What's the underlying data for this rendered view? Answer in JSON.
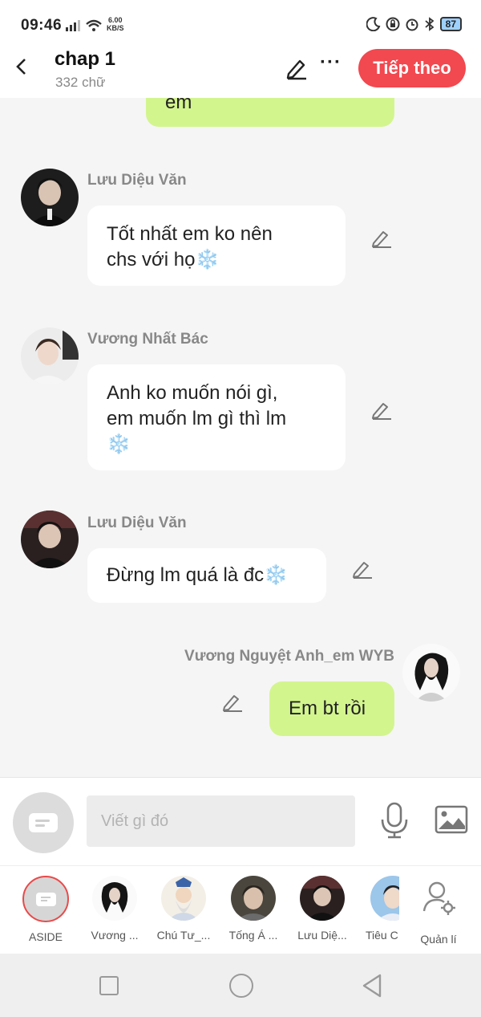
{
  "status_bar": {
    "time": "09:46",
    "speed_value": "6.00",
    "speed_unit": "KB/S",
    "battery": "87",
    "icons": [
      "signal-icon",
      "wifi-icon",
      "moon-icon",
      "lock-rotation-icon",
      "alarm-icon",
      "bluetooth-icon",
      "battery-icon"
    ]
  },
  "header": {
    "title": "chap 1",
    "subtitle": "332 chữ",
    "next_label": "Tiếp theo"
  },
  "messages": [
    {
      "sender": "",
      "text": "em",
      "side": "right"
    },
    {
      "sender": "Lưu Diệu Văn",
      "text_lines": [
        "Tốt nhất em ko nên",
        "chs với họ❄️"
      ],
      "side": "left"
    },
    {
      "sender": "Vương Nhất Bác",
      "text_lines": [
        "Anh ko muốn nói gì,",
        "em muốn lm gì thì lm",
        "❄️"
      ],
      "side": "left"
    },
    {
      "sender": "Lưu Diệu Văn",
      "text": "Đừng lm quá là đc❄️",
      "side": "left"
    },
    {
      "sender": "Vương Nguyệt Anh_em WYB",
      "text": "Em bt rồi",
      "side": "right"
    }
  ],
  "input": {
    "placeholder": "Viết gì đó"
  },
  "characters": [
    {
      "name": "ASIDE"
    },
    {
      "name": "Vương ..."
    },
    {
      "name": "Chú Tư_..."
    },
    {
      "name": "Tống Á ..."
    },
    {
      "name": "Lưu Diệ..."
    },
    {
      "name": "Tiêu C"
    },
    {
      "name": "Quản lí"
    }
  ],
  "colors": {
    "accent": "#f2484f",
    "my_bubble": "#d3f58e",
    "other_bubble": "#ffffff"
  }
}
